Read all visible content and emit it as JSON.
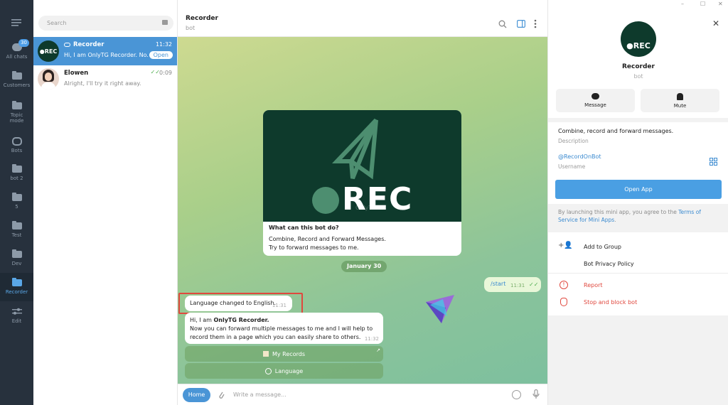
{
  "window": {
    "minimize": "–",
    "maximize": "☐",
    "close": "✕"
  },
  "rail": {
    "menu_icon": "menu-icon",
    "items": [
      {
        "label": "All chats",
        "badge": "30"
      },
      {
        "label": "Customers"
      },
      {
        "label": "Topic mode"
      },
      {
        "label": "Bots"
      },
      {
        "label": "bot 2"
      },
      {
        "label": "5"
      },
      {
        "label": "Test"
      },
      {
        "label": "Dev"
      },
      {
        "label": "Recorder"
      },
      {
        "label": "Edit"
      }
    ]
  },
  "chat_list": {
    "search_placeholder": "Search",
    "chats": [
      {
        "name": "Recorder",
        "time": "11:32",
        "preview": "Hi, I am OnlyTG Recorder. No...",
        "action": "Open",
        "avatar": "●REC"
      },
      {
        "name": "Elowen",
        "time": "0:09",
        "preview": "Alright, I'll try it right away."
      }
    ]
  },
  "header": {
    "title": "Recorder",
    "subtitle": "bot"
  },
  "bot_card": {
    "logo_text": "REC",
    "watermark": "OnlyTG",
    "heading": "What can this bot do?",
    "line1": "Combine, Record and Forward Messages.",
    "line2": "Try to forward messages to me."
  },
  "date_badge": "January 30",
  "messages": {
    "out_text": "/start",
    "out_time": "11:31",
    "lang_text": "Language changed to English.",
    "lang_time": "11:31",
    "greet_prefix": "Hi, I am ",
    "greet_name": "OnlyTG Recorder.",
    "greet_line2": "Now you can forward multiple messages to me and I will help to",
    "greet_line3": "record them in a page which you can easily share to others.",
    "greet_time": "11:32"
  },
  "keyboard": {
    "records": "My Records",
    "language": "Language"
  },
  "composer": {
    "home": "Home",
    "placeholder": "Write a message..."
  },
  "profile": {
    "name": "Recorder",
    "type": "bot",
    "avatar": "●REC",
    "message_btn": "Message",
    "mute_btn": "Mute",
    "description": "Combine, record and forward messages.",
    "description_label": "Description",
    "username": "@RecordOnBot",
    "username_label": "Username",
    "open_app": "Open App",
    "notice_prefix": "By launching this mini app, you agree to the ",
    "notice_link": "Terms of Service for Mini Apps",
    "notice_suffix": ".",
    "add_group": "Add to Group",
    "privacy": "Bot Privacy Policy",
    "report": "Report",
    "block": "Stop and block bot"
  },
  "colors": {
    "accent": "#4a95d6",
    "danger": "#e0483e",
    "rail": "#27313d",
    "logo_bg": "#0e3a2c"
  }
}
